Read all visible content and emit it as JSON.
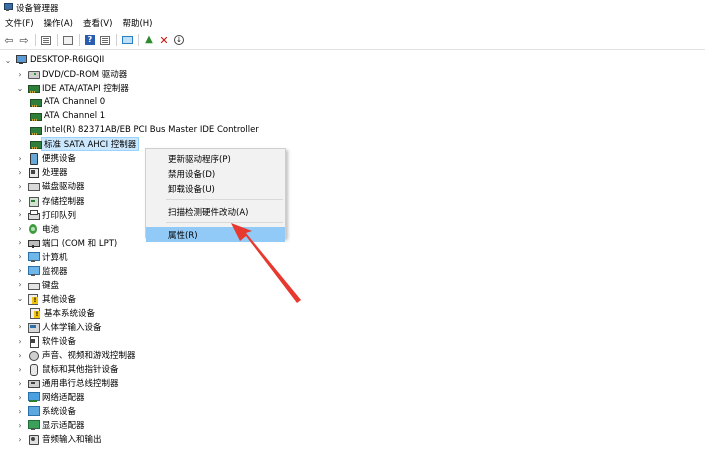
{
  "window": {
    "title": "设备管理器"
  },
  "menu": [
    {
      "id": "file",
      "label": "文件(F)"
    },
    {
      "id": "action",
      "label": "操作(A)"
    },
    {
      "id": "view",
      "label": "查看(V)"
    },
    {
      "id": "help",
      "label": "帮助(H)"
    }
  ],
  "toolbar": {
    "buttons": [
      {
        "name": "back-arrow-icon",
        "glyph": "⇦"
      },
      {
        "name": "forward-arrow-icon",
        "glyph": "⇨"
      },
      {
        "name": "properties-pane-icon"
      },
      {
        "name": "show-hidden-icon"
      },
      {
        "name": "help-icon",
        "glyph": "?"
      },
      {
        "name": "view-list-icon"
      },
      {
        "name": "scan-hardware-icon"
      },
      {
        "name": "update-driver-icon",
        "glyph": "▲"
      },
      {
        "name": "uninstall-device-icon",
        "glyph": "✕"
      },
      {
        "name": "disable-device-icon",
        "glyph": "↓"
      }
    ]
  },
  "tree": {
    "root": "DESKTOP-R6IGQII",
    "nodes": [
      {
        "label": "DVD/CD-ROM 驱动器",
        "icon": "disk",
        "level": 1,
        "expanded": false
      },
      {
        "label": "IDE ATA/ATAPI 控制器",
        "icon": "ide",
        "level": 1,
        "expanded": true
      },
      {
        "label": "ATA Channel 0",
        "icon": "ide",
        "level": 2
      },
      {
        "label": "ATA Channel 1",
        "icon": "ide",
        "level": 2
      },
      {
        "label": "Intel(R) 82371AB/EB PCI Bus Master IDE Controller",
        "icon": "ide",
        "level": 2
      },
      {
        "label": "标准 SATA AHCI 控制器",
        "icon": "ide",
        "level": 2,
        "selected": true
      },
      {
        "label": "便携设备",
        "icon": "portable",
        "level": 1,
        "expanded": false
      },
      {
        "label": "处理器",
        "icon": "cpu",
        "level": 1,
        "expanded": false
      },
      {
        "label": "磁盘驱动器",
        "icon": "drive",
        "level": 1,
        "expanded": false
      },
      {
        "label": "存储控制器",
        "icon": "storage",
        "level": 1,
        "expanded": false
      },
      {
        "label": "打印队列",
        "icon": "printq",
        "level": 1,
        "expanded": false
      },
      {
        "label": "电池",
        "icon": "battery",
        "level": 1,
        "expanded": false
      },
      {
        "label": "端口 (COM 和 LPT)",
        "icon": "port",
        "level": 1,
        "expanded": false
      },
      {
        "label": "计算机",
        "icon": "monitor",
        "level": 1,
        "expanded": false
      },
      {
        "label": "监视器",
        "icon": "monitor",
        "level": 1,
        "expanded": false
      },
      {
        "label": "键盘",
        "icon": "keyboard",
        "level": 1,
        "expanded": false
      },
      {
        "label": "其他设备",
        "icon": "warn",
        "level": 1,
        "expanded": true
      },
      {
        "label": "基本系统设备",
        "icon": "warn",
        "level": 2
      },
      {
        "label": "人体学输入设备",
        "icon": "hid",
        "level": 1,
        "expanded": false
      },
      {
        "label": "软件设备",
        "icon": "soft",
        "level": 1,
        "expanded": false
      },
      {
        "label": "声音、视频和游戏控制器",
        "icon": "sound",
        "level": 1,
        "expanded": false
      },
      {
        "label": "鼠标和其他指针设备",
        "icon": "mouse",
        "level": 1,
        "expanded": false
      },
      {
        "label": "通用串行总线控制器",
        "icon": "usb",
        "level": 1,
        "expanded": false
      },
      {
        "label": "网络适配器",
        "icon": "net",
        "level": 1,
        "expanded": false
      },
      {
        "label": "系统设备",
        "icon": "sys",
        "level": 1,
        "expanded": false
      },
      {
        "label": "显示适配器",
        "icon": "display",
        "level": 1,
        "expanded": false
      },
      {
        "label": "音频输入和输出",
        "icon": "audio",
        "level": 1,
        "expanded": false
      }
    ]
  },
  "context_menu": {
    "items": [
      {
        "label": "更新驱动程序(P)",
        "name": "cm-update-driver"
      },
      {
        "label": "禁用设备(D)",
        "name": "cm-disable-device"
      },
      {
        "label": "卸载设备(U)",
        "name": "cm-uninstall-device"
      },
      {
        "separator": true
      },
      {
        "label": "扫描检测硬件改动(A)",
        "name": "cm-scan-hardware"
      },
      {
        "separator": true
      },
      {
        "label": "属性(R)",
        "name": "cm-properties",
        "active": true
      }
    ]
  },
  "annotation": {
    "arrow_color": "#e8392f"
  }
}
